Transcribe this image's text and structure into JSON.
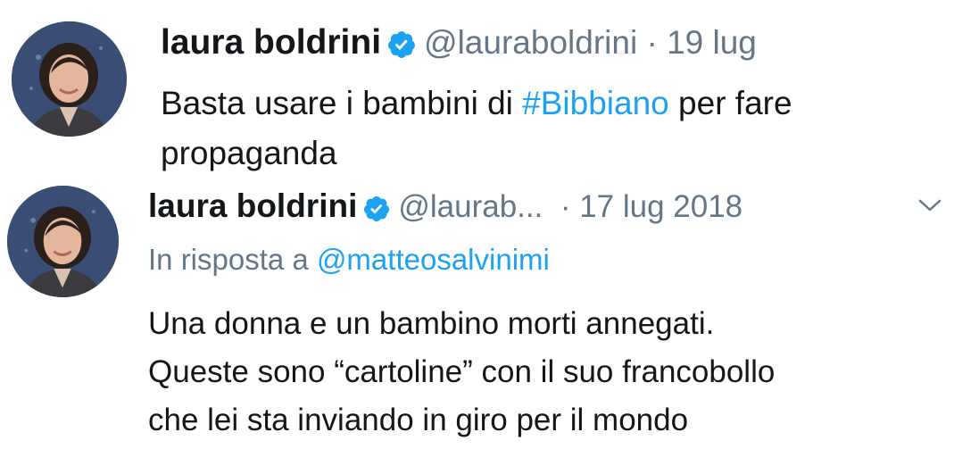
{
  "tweet1": {
    "author": "laura boldrini",
    "handle": "@lauraboldrini",
    "separator": "·",
    "date": "19 lug",
    "text_before": "Basta usare i bambini di ",
    "hashtag": "#Bibbiano",
    "text_after": " per fare\npropaganda"
  },
  "tweet2": {
    "author": "laura boldrini",
    "handle": "@laurab...",
    "separator": "·",
    "date": "17 lug 2018",
    "reply_prefix": "In risposta a ",
    "reply_mention": "@matteosalvinimi",
    "text": "Una donna e un bambino morti annegati.\nQueste sono “cartoline” con il suo francobollo\nche lei sta inviando in giro per il mondo"
  },
  "colors": {
    "link": "#1da1f2",
    "meta": "#657786",
    "verified": "#1da1f2"
  },
  "icons": {
    "verified": "verified-badge-icon",
    "more": "chevron-down-icon"
  }
}
